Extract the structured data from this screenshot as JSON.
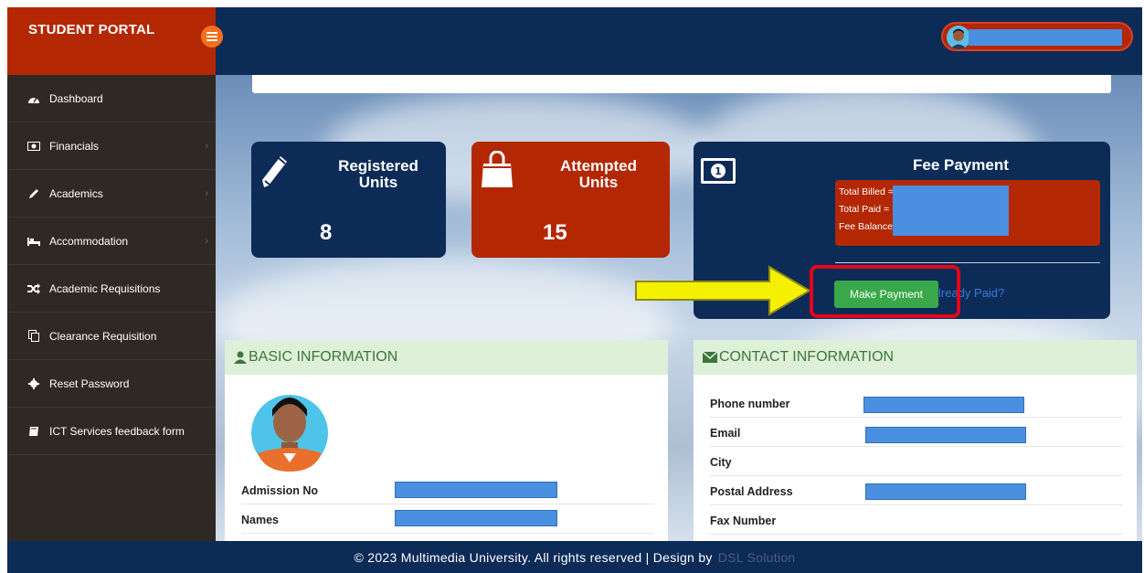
{
  "brand": {
    "title": "STUDENT PORTAL"
  },
  "icons": {
    "menu": "menu-icon",
    "avatar": "user-avatar-icon"
  },
  "sidebar": {
    "items": [
      {
        "label": "Dashboard",
        "icon": "dashboard-icon",
        "has_submenu": false
      },
      {
        "label": "Financials",
        "icon": "money-icon",
        "has_submenu": true
      },
      {
        "label": "Academics",
        "icon": "pencil-icon",
        "has_submenu": true
      },
      {
        "label": "Accommodation",
        "icon": "bed-icon",
        "has_submenu": true
      },
      {
        "label": "Academic Requisitions",
        "icon": "random-icon",
        "has_submenu": false
      },
      {
        "label": "Clearance Requisition",
        "icon": "copy-icon",
        "has_submenu": false
      },
      {
        "label": "Reset Password",
        "icon": "gear-icon",
        "has_submenu": false
      },
      {
        "label": "ICT Services feedback form",
        "icon": "book-icon",
        "has_submenu": false
      }
    ]
  },
  "stats": {
    "registered": {
      "title_line1": "Registered",
      "title_line2": "Units",
      "value": "8"
    },
    "attempted": {
      "title_line1": "Attempted",
      "title_line2": "Units",
      "value": "15"
    }
  },
  "fee": {
    "title": "Fee Payment",
    "billed_label": "Total Billed =",
    "paid_label": "Total Paid = K",
    "balance_label": "Fee Balance =",
    "pay_button": "Make Payment",
    "already_paid": "lready Paid?"
  },
  "basic_info": {
    "heading": "BASIC INFORMATION",
    "rows": [
      {
        "label": "Admission No"
      },
      {
        "label": "Names"
      }
    ]
  },
  "contact_info": {
    "heading": "CONTACT INFORMATION",
    "rows": [
      {
        "label": "Phone number"
      },
      {
        "label": "Email"
      },
      {
        "label": "City"
      },
      {
        "label": "Postal Address"
      },
      {
        "label": "Fax Number"
      }
    ]
  },
  "footer": {
    "text": "© 2023 Multimedia University. All rights reserved | Design by",
    "credit": "DSL Solution"
  },
  "colors": {
    "navy": "#0d2b57",
    "brand_red": "#b32703",
    "sidebar": "#2f2925",
    "pay_green": "#3aa84a",
    "highlight_red": "#e4061b",
    "arrow_yellow": "#f5f000",
    "panel_head_green": "#dff0d8"
  }
}
